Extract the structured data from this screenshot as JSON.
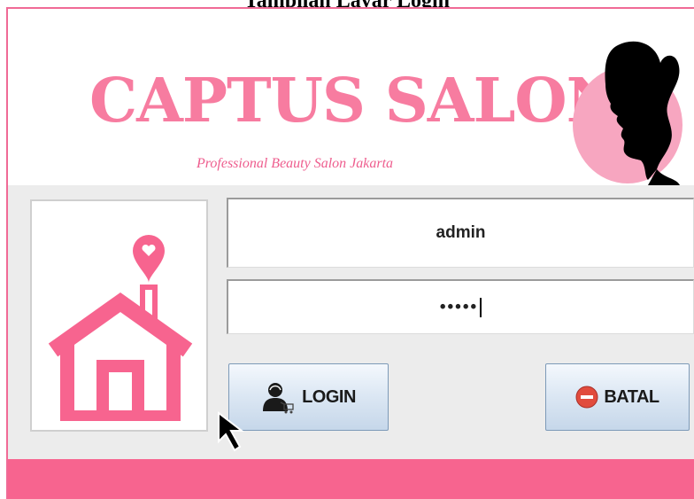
{
  "caption_text": "Tampilan Layar Login",
  "app": {
    "brand_title": "CAPTUS SALON",
    "brand_subtitle": "Professional Beauty Salon Jakarta",
    "logo_icon": "woman-silhouette-icon",
    "side_icon": "house-heart-icon"
  },
  "form": {
    "username_value": "admin",
    "password_value": "•••••"
  },
  "buttons": {
    "login_label": "LOGIN",
    "login_icon": "user-cart-icon",
    "cancel_label": "BATAL",
    "cancel_icon": "minus-circle-icon"
  },
  "colors": {
    "accent_pink": "#f77ca0",
    "footer_pink": "#f7648f",
    "logo_circle": "#f7a6c0"
  }
}
